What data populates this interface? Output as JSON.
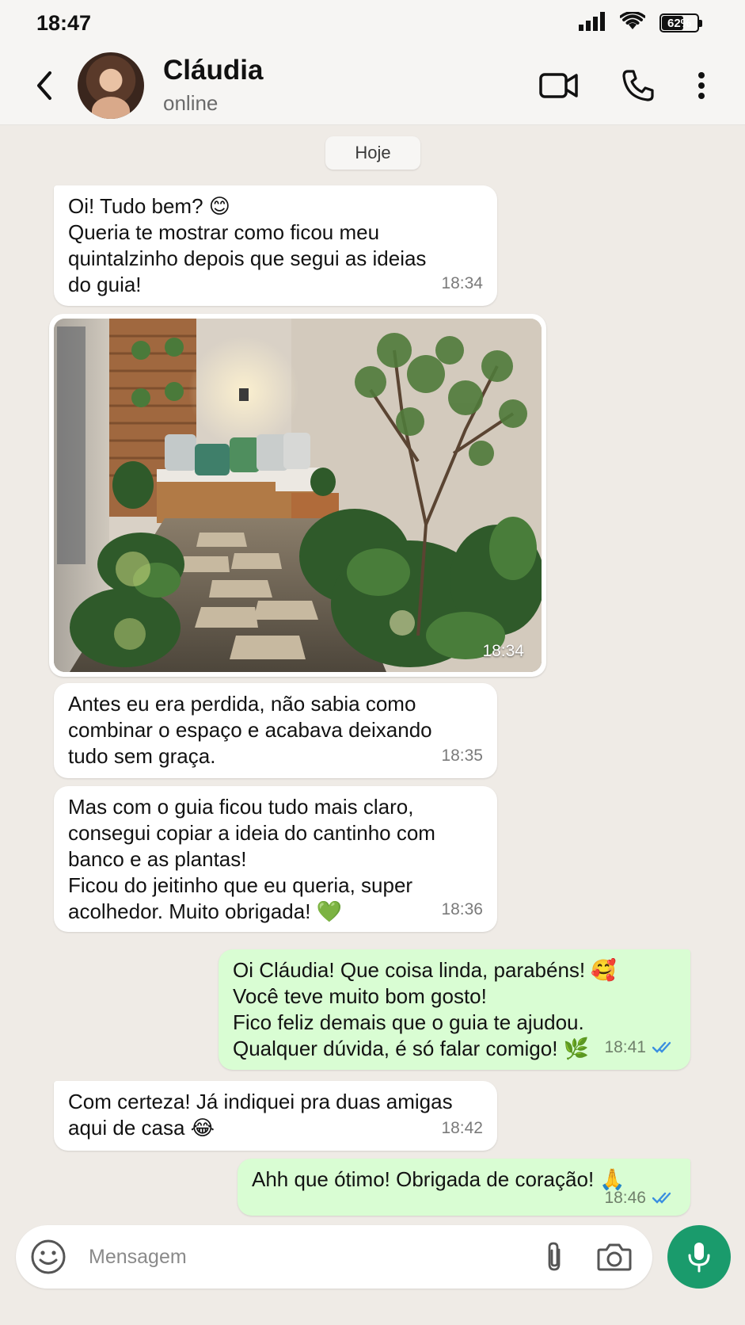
{
  "status_bar": {
    "time": "18:47",
    "battery": "62%",
    "battery_level": 0.62
  },
  "header": {
    "name": "Cláudia",
    "status": "online"
  },
  "chat": {
    "date_chip": "Hoje",
    "messages": [
      {
        "dir": "in",
        "text": "Oi! Tudo bem? 😊\nQueria te mostrar como ficou meu\nquintalzinho depois que segui as ideias\ndo guia!",
        "time": "18:34"
      },
      {
        "dir": "in",
        "type": "image",
        "time": "18:34"
      },
      {
        "dir": "in",
        "text": "Antes eu era perdida, não sabia como\ncombinar o espaço e acabava deixando\ntudo sem graça.",
        "time": "18:35"
      },
      {
        "dir": "in",
        "text": "Mas com o guia ficou tudo mais claro,\nconsegui copiar a ideia do cantinho com\nbanco e as plantas!\nFicou do jeitinho que eu queria, super\nacolhedor. Muito obrigada! 💚",
        "time": "18:36"
      },
      {
        "dir": "out",
        "text": "Oi Cláudia! Que coisa linda, parabéns! 🥰\nVocê teve muito bom gosto!\nFico feliz demais que o guia te ajudou.\nQualquer dúvida, é só falar comigo! 🌿",
        "time": "18:41",
        "read": true
      },
      {
        "dir": "in",
        "text": "Com certeza! Já indiquei pra duas amigas\naqui de casa 😂",
        "time": "18:42"
      },
      {
        "dir": "out",
        "text": "Ahh que ótimo! Obrigada de coração! 🙏",
        "time": "18:46",
        "read": true
      }
    ]
  },
  "composer": {
    "placeholder": "Mensagem"
  },
  "colors": {
    "accent": "#1a9b6c",
    "outgoing": "#d9fdd3",
    "incoming": "#ffffff",
    "read_ticks": "#3b8fe0",
    "background": "#efebe6"
  }
}
